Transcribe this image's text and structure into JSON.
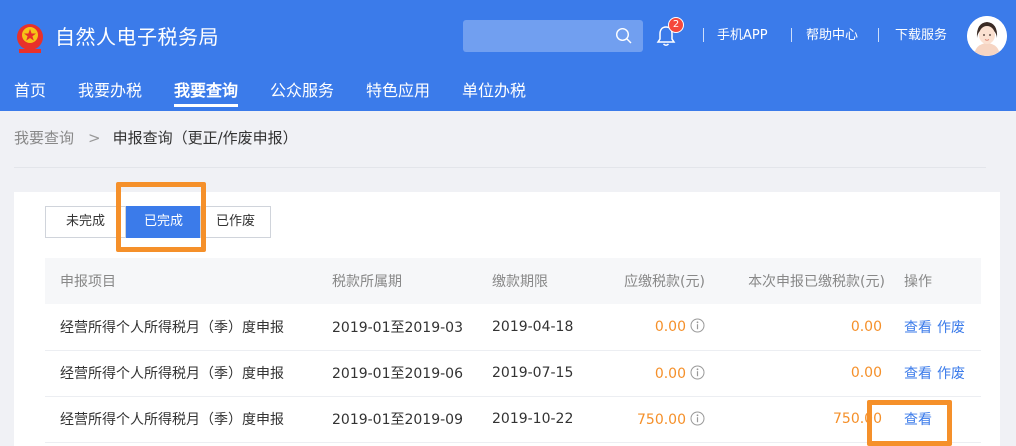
{
  "header": {
    "site_title": "自然人电子税务局",
    "search_placeholder": "",
    "notification_count": "2",
    "links": [
      "手机APP",
      "帮助中心",
      "下载服务"
    ]
  },
  "nav": {
    "items": [
      "首页",
      "我要办税",
      "我要查询",
      "公众服务",
      "特色应用",
      "单位办税"
    ],
    "active": "我要查询"
  },
  "breadcrumb": {
    "parent": "我要查询",
    "current": "申报查询（更正/作废申报）"
  },
  "tabs": {
    "items": [
      "未完成",
      "已完成",
      "已作废"
    ],
    "active": "已完成"
  },
  "table": {
    "headers": [
      "申报项目",
      "税款所属期",
      "缴款期限",
      "应缴税款(元)",
      "本次申报已缴税款(元)",
      "操作"
    ],
    "rows": [
      {
        "item": "经营所得个人所得税月（季）度申报",
        "period": "2019-01至2019-03",
        "deadline": "2019-04-18",
        "tax_due": "0.00",
        "paid": "0.00",
        "actions": [
          "查看",
          "作废"
        ]
      },
      {
        "item": "经营所得个人所得税月（季）度申报",
        "period": "2019-01至2019-06",
        "deadline": "2019-07-15",
        "tax_due": "0.00",
        "paid": "0.00",
        "actions": [
          "查看",
          "作废"
        ]
      },
      {
        "item": "经营所得个人所得税月（季）度申报",
        "period": "2019-01至2019-09",
        "deadline": "2019-10-22",
        "tax_due": "750.00",
        "paid": "750.00",
        "actions": [
          "查看"
        ]
      }
    ]
  },
  "colors": {
    "header_blue": "#3b7bea",
    "highlight_orange": "#f5902a",
    "amount_orange": "#f5902a",
    "link_blue": "#3b7bea"
  }
}
